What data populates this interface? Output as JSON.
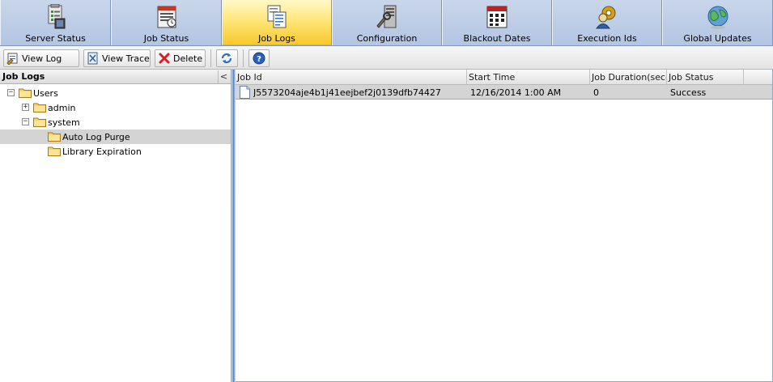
{
  "tabs": [
    {
      "label": "Server Status",
      "icon": "server-status-icon",
      "active": false
    },
    {
      "label": "Job Status",
      "icon": "job-status-icon",
      "active": false
    },
    {
      "label": "Job Logs",
      "icon": "job-logs-icon",
      "active": true
    },
    {
      "label": "Configuration",
      "icon": "configuration-icon",
      "active": false
    },
    {
      "label": "Blackout Dates",
      "icon": "calendar-icon",
      "active": false
    },
    {
      "label": "Execution Ids",
      "icon": "execution-ids-icon",
      "active": false
    },
    {
      "label": "Global Updates",
      "icon": "global-updates-icon",
      "active": false
    }
  ],
  "toolbar": {
    "view_log": "View Log",
    "view_trace": "View Trace",
    "delete": "Delete",
    "refresh_icon": "refresh-icon",
    "help_icon": "help-icon"
  },
  "tree": {
    "title": "Job Logs",
    "collapse": "<",
    "items": [
      {
        "label": "Users",
        "expander": "−"
      },
      {
        "label": "admin",
        "expander": "+"
      },
      {
        "label": "system",
        "expander": "−"
      },
      {
        "label": "Auto Log Purge",
        "selected": true
      },
      {
        "label": "Library Expiration"
      }
    ]
  },
  "grid": {
    "columns": [
      "Job Id",
      "Start Time",
      "Job Duration(seconds)",
      "Job Status"
    ],
    "rows": [
      {
        "job_id": "J5573204aje4b1j41eejbef2j0139dfb74427",
        "start_time": "12/16/2014 1:00 AM",
        "duration": "0",
        "status": "Success"
      }
    ]
  },
  "colors": {
    "tab_bg": "#c5d3e8",
    "tab_active": "#ffe77a",
    "splitter": "#4f7fc7",
    "selection": "#d4d4d4"
  }
}
